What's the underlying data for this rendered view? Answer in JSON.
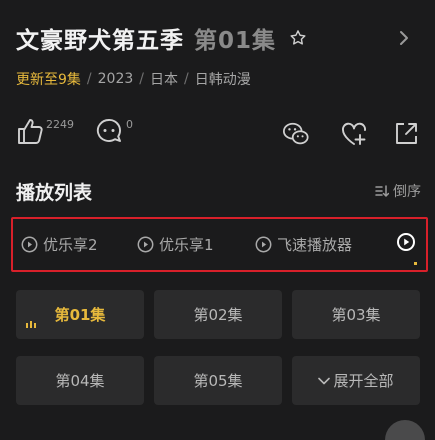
{
  "header": {
    "title": "文豪野犬第五季",
    "episode": "第01集"
  },
  "meta": {
    "update": "更新至9集",
    "year": "2023",
    "region": "日本",
    "genre": "日韩动漫",
    "sep": "/"
  },
  "actions": {
    "likes": "2249",
    "comments": "0"
  },
  "playlist": {
    "title": "播放列表",
    "sort_label": "倒序"
  },
  "sources": [
    {
      "label": "优乐享2"
    },
    {
      "label": "优乐享1"
    },
    {
      "label": "飞速播放器"
    }
  ],
  "episodes": [
    "第01集",
    "第02集",
    "第03集",
    "第04集",
    "第05集"
  ],
  "expand_label": "展开全部",
  "colors": {
    "accent": "#e7b93c",
    "highlight_border": "#d8202a",
    "background": "#1b1b1c",
    "button_bg": "#2b2b2c"
  }
}
